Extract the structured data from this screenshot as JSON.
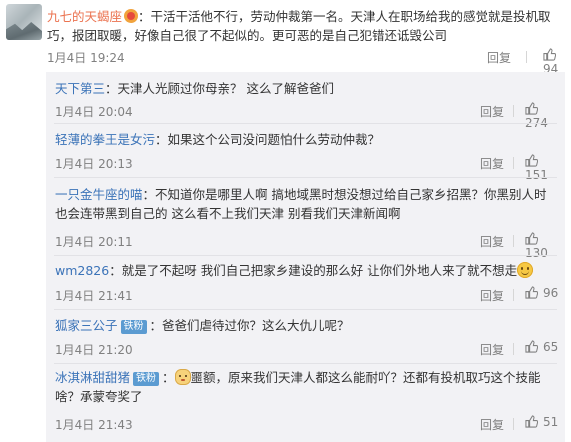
{
  "main_comment": {
    "username": "九七的天蝎座",
    "text": "：干活干活他不行，劳动仲裁第一名。天津人在职场给我的感觉就是投机取巧，报团取暖，好像自己很了不起似的。更可恶的是自己犯错还诋毁公司",
    "date": "1月4日 19:24",
    "reply_label": "回复",
    "likes": "94",
    "badge_icon": "vip-medal-icon"
  },
  "replies": [
    {
      "username": "天下第三",
      "text": "：天津人光顾过你母亲？ 这么了解爸爸们",
      "date": "1月4日 20:04",
      "reply_label": "回复",
      "likes": "274"
    },
    {
      "username": "轻薄的拳王是女污",
      "text": "：如果这个公司没问题怕什么劳动仲裁？",
      "date": "1月4日 20:13",
      "reply_label": "回复",
      "likes": "151"
    },
    {
      "username": "一只金牛座的喵",
      "text": "：不知道你是哪里人啊 搞地域黑时想没想过给自己家乡招黑？你黑别人时 也会连带黑到自己的 这么看不上我们天津 别看我们天津新闻啊",
      "date": "1月4日 20:11",
      "reply_label": "回复",
      "likes": "130"
    },
    {
      "username": "wm2826",
      "text": "：就是了不起呀 我们自己把家乡建设的那么好 让你们外地人来了就不想走",
      "date": "1月4日 21:41",
      "reply_label": "回复",
      "likes": "96",
      "emoji": "smile-emoji"
    },
    {
      "username": "狐家三公子",
      "tag": "铁粉",
      "text": "：爸爸们虐待过你？这么大仇儿呢？",
      "date": "1月4日 21:20",
      "reply_label": "回复",
      "likes": "65"
    },
    {
      "username": "冰淇淋甜甜猪",
      "tag": "铁粉",
      "text": "：",
      "text2": "噩额，原来我们天津人都这么能耐吖？还都有投机取巧这个技能啥？承蒙夸奖了",
      "date": "1月4日 21:43",
      "reply_label": "回复",
      "likes": "51",
      "emoji": "cat-emoji"
    }
  ],
  "colors": {
    "username": "#eb7350",
    "reply_username": "#3b73b8",
    "tag": "#5b9bd1",
    "meta": "#808080",
    "replies_bg": "#f2f2f5"
  }
}
